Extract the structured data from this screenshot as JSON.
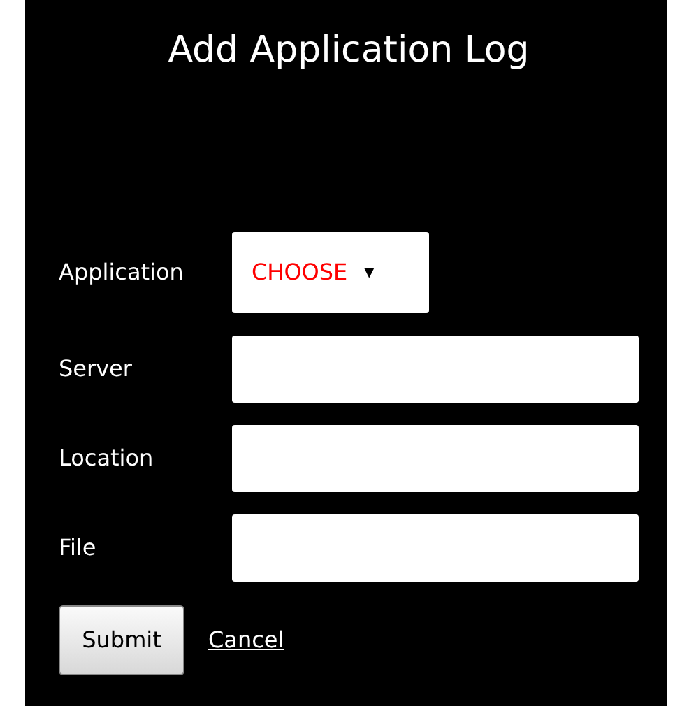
{
  "title": "Add Application Log",
  "fields": [
    {
      "kind": "select",
      "label": "Application",
      "value": "CHOOSE",
      "caret": "▾"
    },
    {
      "kind": "text",
      "label": "Server"
    },
    {
      "kind": "text",
      "label": "Location"
    },
    {
      "kind": "text",
      "label": "File"
    }
  ],
  "submit": "Submit",
  "cancel": "Cancel"
}
